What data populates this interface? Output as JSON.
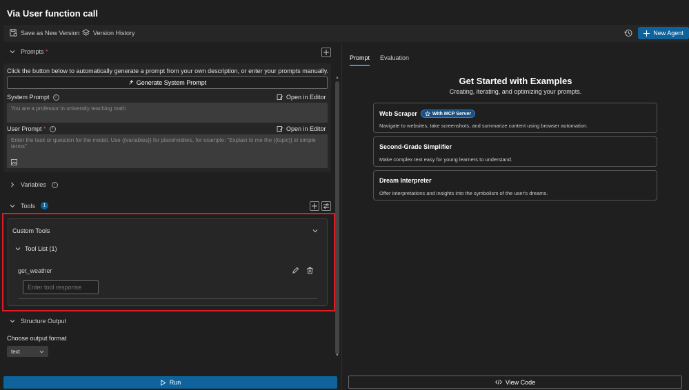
{
  "app": {
    "title": "Via User function call"
  },
  "toolbar": {
    "save_label": "Save as New Version",
    "version_history_label": "Version History",
    "new_agent_label": "New Agent"
  },
  "prompts": {
    "header": "Prompts",
    "required_mark": "*",
    "description": "Click the button below to automatically generate a prompt from your own description, or enter your prompts manually.",
    "generate_label": "Generate System Prompt",
    "system_label": "System Prompt",
    "system_value": "You are a professor in university teaching math",
    "open_editor_label": "Open in Editor",
    "user_label": "User Prompt",
    "user_placeholder": "Enter the task or question for the model. Use {{variables}} for placeholders, for example: \"Explain to me the {{topic}} in simple terms\""
  },
  "variables": {
    "header": "Variables"
  },
  "tools": {
    "header": "Tools",
    "count": "1",
    "custom_tools_label": "Custom Tools",
    "tool_list_label": "Tool List (1)",
    "items": [
      {
        "name": "get_weather",
        "response_placeholder": "Enter tool response"
      }
    ]
  },
  "structure_output": {
    "header": "Structure Output",
    "format_label": "Choose output format",
    "format_value": "text"
  },
  "run_label": "Run",
  "right": {
    "tabs": [
      {
        "label": "Prompt",
        "active": true
      },
      {
        "label": "Evaluation",
        "active": false
      }
    ],
    "title": "Get Started with Examples",
    "subtitle": "Creating, iterating, and optimizing your prompts.",
    "examples": [
      {
        "title": "Web Scraper",
        "badge": "With MCP Server",
        "desc": "Navigate to websites, take screenshots, and summarize content using browser automation."
      },
      {
        "title": "Second-Grade Simplifier",
        "badge": "",
        "desc": "Make complex text easy for young learners to understand."
      },
      {
        "title": "Dream Interpreter",
        "badge": "",
        "desc": "Offer interpretations and insights into the symbolism of the user's dreams."
      }
    ],
    "view_code_label": "View Code"
  },
  "colors": {
    "accent": "#0e639c",
    "highlight": "#e01b24",
    "background": "#1f1f1f"
  }
}
